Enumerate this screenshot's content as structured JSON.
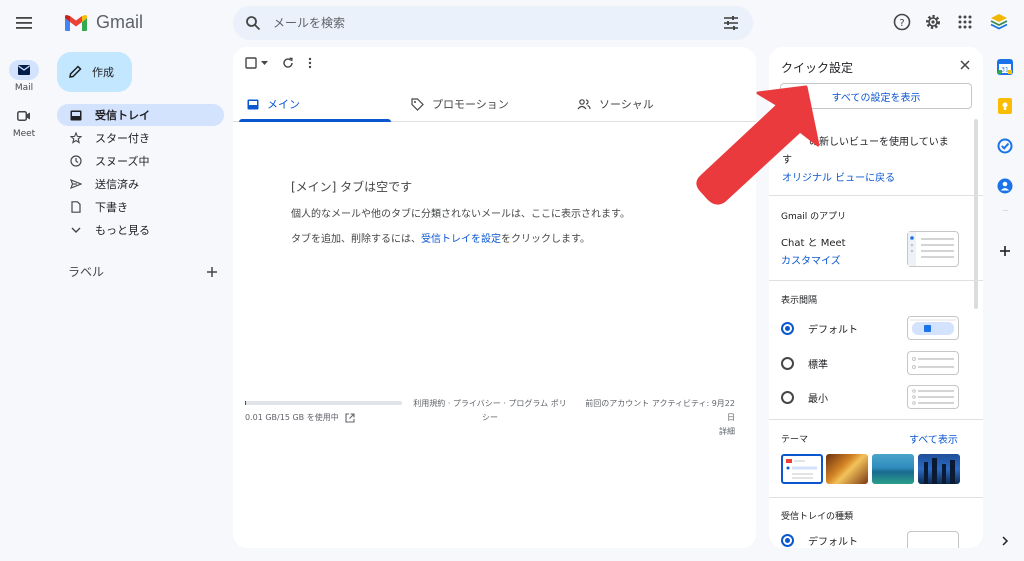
{
  "search": {
    "placeholder": "メールを検索"
  },
  "brand": {
    "name": "Gmail"
  },
  "rail": {
    "mail_label": "Mail",
    "meet_label": "Meet"
  },
  "compose_label": "作成",
  "nav": [
    {
      "label": "受信トレイ"
    },
    {
      "label": "スター付き"
    },
    {
      "label": "スヌーズ中"
    },
    {
      "label": "送信済み"
    },
    {
      "label": "下書き"
    },
    {
      "label": "もっと見る"
    }
  ],
  "labels_header": "ラベル",
  "tabs": [
    {
      "label": "メイン"
    },
    {
      "label": "プロモーション"
    },
    {
      "label": "ソーシャル"
    }
  ],
  "empty": {
    "title": "[メイン] タブは空です",
    "desc": "個人的なメールや他のタブに分類されないメールは、ここに表示されます。",
    "desc2_pre": "タブを追加、削除するには、",
    "desc2_link": "受信トレイを設定",
    "desc2_post": "をクリックします。"
  },
  "footer": {
    "storage": "0.01 GB/15 GB を使用中",
    "storage_fraction": 0.0007,
    "links_line1": "利用規約 · プライバシー · プログラム ポリ",
    "links_line2": "シー",
    "activity_line1": "前回のアカウント アクティビティ: 9月22",
    "activity_line2": "日",
    "activity_line3": "詳細"
  },
  "quick_settings": {
    "title": "クイック設定",
    "all_settings": "すべての設定を表示",
    "new_view_line1": "の新しいビューを使用していま",
    "new_view_line2": "す",
    "original_view": "オリジナル ビューに戻る",
    "apps_section": "Gmail のアプリ",
    "chat_meet": "Chat と Meet",
    "customize": "カスタマイズ",
    "density_section": "表示間隔",
    "density_options": [
      "デフォルト",
      "標準",
      "最小"
    ],
    "density_selected": "デフォルト",
    "theme_section": "テーマ",
    "theme_all": "すべて表示",
    "inbox_type_section": "受信トレイの種類",
    "inbox_type_option": "デフォルト"
  },
  "colors": {
    "accent": "#0b57d0",
    "selected_nav": "#d3e3fd",
    "compose": "#c2e7ff",
    "arrow": "#ea3a3d"
  }
}
